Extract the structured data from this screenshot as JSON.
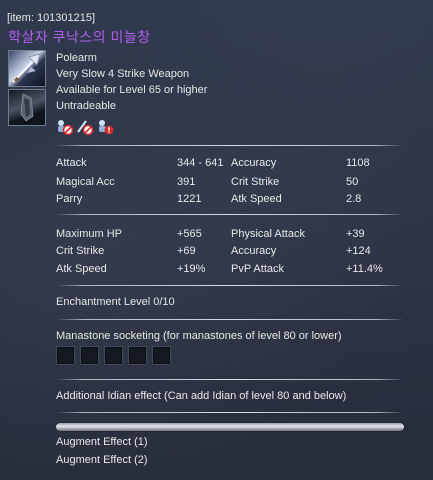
{
  "item": {
    "code_label": "[item: 101301215]",
    "name": "학살자 쿠낙스의 미늘창",
    "weapon_type": "Polearm",
    "speed_strikes": "Very Slow 4 Strike Weapon",
    "level_req": "Available for Level 65 or higher",
    "trade": "Untradeable",
    "name_color": "#b25ef0",
    "restriction_icons": [
      "no-trade-icon",
      "no-sell-icon",
      "no-warehouse-icon"
    ]
  },
  "stats_base": [
    {
      "label": "Attack",
      "value": "344 - 641",
      "label2": "Accuracy",
      "value2": "1108"
    },
    {
      "label": "Magical Acc",
      "value": "391",
      "label2": "Crit Strike",
      "value2": "50"
    },
    {
      "label": "Parry",
      "value": "1221",
      "label2": "Atk Speed",
      "value2": "2.8"
    }
  ],
  "stats_bonus": [
    {
      "label": "Maximum HP",
      "value": "+565",
      "label2": "Physical Attack",
      "value2": "+39"
    },
    {
      "label": "Crit Strike",
      "value": "+69",
      "label2": "Accuracy",
      "value2": "+124"
    },
    {
      "label": "Atk Speed",
      "value": "+19%",
      "label2": "PvP Attack",
      "value2": "+11.4%"
    }
  ],
  "enchantment": "Enchantment Level 0/10",
  "manastone": {
    "label": "Manastone socketing (for manastones of level 80 or lower)",
    "slot_count": 5
  },
  "idian": "Additional Idian effect (Can add Idian of level 80 and below)",
  "augments": [
    "Augment Effect (1)",
    "Augment Effect (2)"
  ]
}
